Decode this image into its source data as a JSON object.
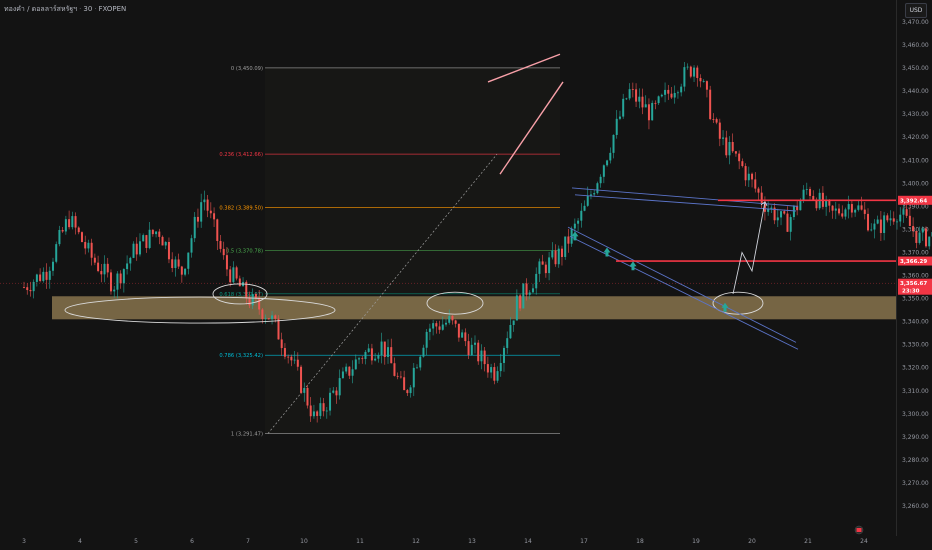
{
  "header": {
    "symbol": "ทองคำ / ดอลลาร์สหรัฐฯ",
    "interval": "30",
    "source": "FXOPEN"
  },
  "currency": "USD",
  "colors": {
    "background": "#131313",
    "candle_up": "#26a69a",
    "candle_down": "#ef5350",
    "resistance": "#f23645",
    "demand_zone": "#c8aa6e",
    "channel": "#5b74c9",
    "wedge": "#f8a0a8",
    "ellipse": "#d9d9d9",
    "arrow": "#26a69a"
  },
  "chart_data": {
    "type": "candlestick",
    "y_axis": {
      "min": 3260,
      "max": 3470,
      "ticks": [
        "3,470.00",
        "3,460.00",
        "3,450.00",
        "3,440.00",
        "3,430.00",
        "3,420.00",
        "3,410.00",
        "3,400.00",
        "3,390.00",
        "3,380.00",
        "3,370.00",
        "3,360.00",
        "3,350.00",
        "3,340.00",
        "3,330.00",
        "3,320.00",
        "3,310.00",
        "3,300.00",
        "3,290.00",
        "3,280.00",
        "3,270.00",
        "3,260.00"
      ]
    },
    "x_axis": {
      "labels": [
        "3",
        "4",
        "5",
        "6",
        "7",
        "10",
        "11",
        "12",
        "13",
        "14",
        "17",
        "18",
        "19",
        "20",
        "21",
        "24"
      ]
    },
    "price_path": [
      [
        3,
        3355
      ],
      [
        3.4,
        3362
      ],
      [
        3.8,
        3385
      ],
      [
        4.2,
        3368
      ],
      [
        4.6,
        3356
      ],
      [
        5.0,
        3372
      ],
      [
        5.4,
        3380
      ],
      [
        5.8,
        3360
      ],
      [
        6.2,
        3395
      ],
      [
        6.6,
        3364
      ],
      [
        7.0,
        3350
      ],
      [
        7.4,
        3342
      ],
      [
        7.8,
        3322
      ],
      [
        8.2,
        3297
      ],
      [
        8.6,
        3312
      ],
      [
        9.0,
        3325
      ],
      [
        9.4,
        3330
      ],
      [
        9.8,
        3308
      ],
      [
        10.2,
        3337
      ],
      [
        10.6,
        3340
      ],
      [
        11.0,
        3328
      ],
      [
        11.4,
        3318
      ],
      [
        11.8,
        3348
      ],
      [
        12.2,
        3362
      ],
      [
        12.6,
        3370
      ],
      [
        13.0,
        3388
      ],
      [
        13.4,
        3412
      ],
      [
        13.8,
        3440
      ],
      [
        14.2,
        3430
      ],
      [
        14.6,
        3442
      ],
      [
        15.0,
        3452
      ],
      [
        15.4,
        3420
      ],
      [
        15.8,
        3408
      ],
      [
        16.2,
        3392
      ],
      [
        16.6,
        3382
      ],
      [
        17.0,
        3398
      ],
      [
        17.4,
        3386
      ],
      [
        17.8,
        3392
      ],
      [
        18.2,
        3380
      ],
      [
        18.6,
        3388
      ],
      [
        19.0,
        3376
      ],
      [
        19.4,
        3378
      ],
      [
        19.8,
        3366
      ],
      [
        20.2,
        3352
      ]
    ],
    "fibonacci": [
      {
        "label": "0 (3,450.09)",
        "value": 3450.09,
        "color": "#9e9e9e"
      },
      {
        "label": "0.236 (3,412.66)",
        "value": 3412.66,
        "color": "#f23645"
      },
      {
        "label": "0.382 (3,389.50)",
        "value": 3389.5,
        "color": "#ff9800"
      },
      {
        "label": "0.5 (3,370.78)",
        "value": 3370.78,
        "color": "#4caf50"
      },
      {
        "label": "0.618 (3,352.07)",
        "value": 3352.07,
        "color": "#089981"
      },
      {
        "label": "0.786 (3,325.42)",
        "value": 3325.42,
        "color": "#00bcd4"
      },
      {
        "label": "1 (3,291.47)",
        "value": 3291.47,
        "color": "#9e9e9e"
      }
    ],
    "demand_zone": {
      "low": 3341,
      "high": 3351
    },
    "resistance_levels": [
      {
        "value": 3392.64,
        "label": "3,392.64"
      },
      {
        "value": 3366.29,
        "label": "3,366.29"
      }
    ],
    "current_price": {
      "value": 3356.67,
      "label": "3,356.67",
      "countdown": "23:30"
    },
    "grid": false,
    "legend": "none"
  }
}
